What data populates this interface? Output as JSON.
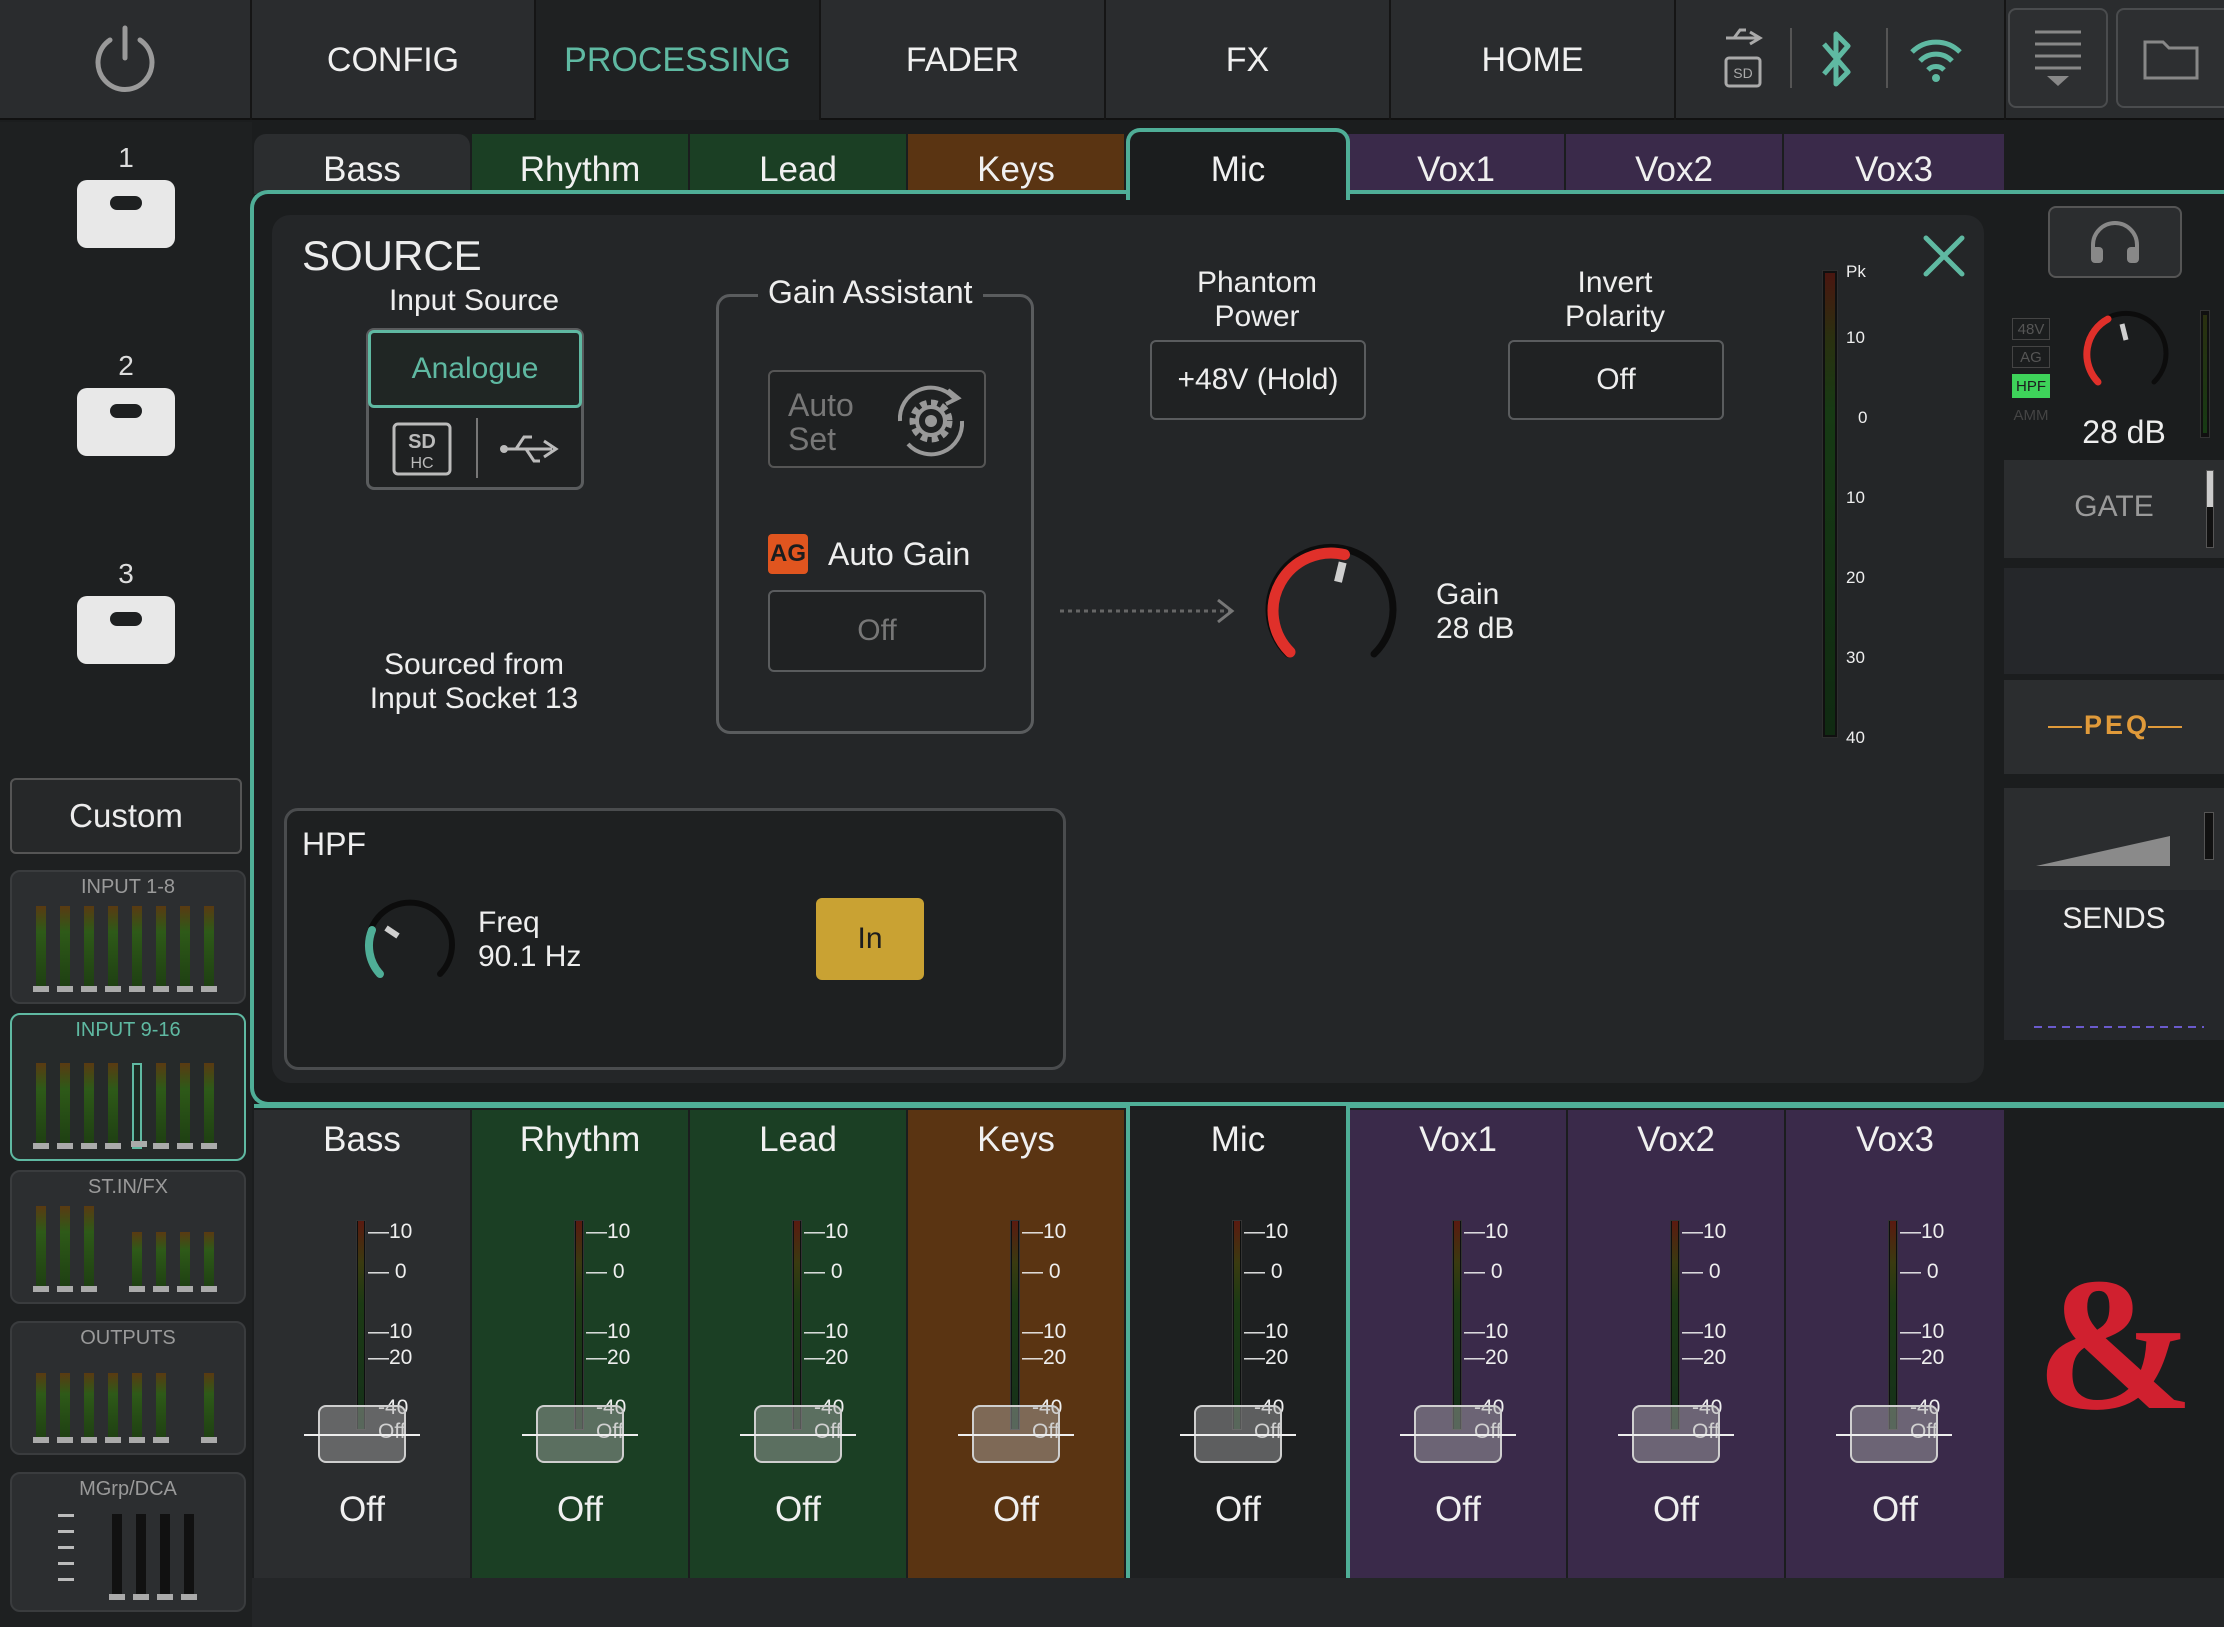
{
  "topbar": {
    "tabs": [
      {
        "label": "CONFIG"
      },
      {
        "label": "PROCESSING"
      },
      {
        "label": "FADER"
      },
      {
        "label": "FX"
      },
      {
        "label": "HOME"
      }
    ],
    "active_tab": "PROCESSING"
  },
  "scenes": [
    {
      "num": "1"
    },
    {
      "num": "2"
    },
    {
      "num": "3"
    }
  ],
  "left": {
    "custom_label": "Custom",
    "banks": [
      {
        "label": "INPUT 1-8"
      },
      {
        "label": "INPUT 9-16"
      },
      {
        "label": "ST.IN/FX"
      },
      {
        "label": "OUTPUTS"
      },
      {
        "label": "MGrp/DCA"
      }
    ]
  },
  "channel_tabs": [
    "Bass",
    "Rhythm",
    "Lead",
    "Keys",
    "Mic",
    "Vox1",
    "Vox2",
    "Vox3"
  ],
  "source": {
    "title": "SOURCE",
    "input_source_label": "Input Source",
    "input_source_value": "Analogue",
    "sourced_line1": "Sourced from",
    "sourced_line2": "Input Socket 13",
    "gain_assistant_title": "Gain Assistant",
    "auto_set_line1": "Auto",
    "auto_set_line2": "Set",
    "ag_badge": "AG",
    "auto_gain_label": "Auto Gain",
    "auto_gain_value": "Off",
    "phantom_line1": "Phantom",
    "phantom_line2": "Power",
    "phantom_value": "+48V (Hold)",
    "invert_line1": "Invert",
    "invert_line2": "Polarity",
    "invert_value": "Off",
    "gain_label": "Gain",
    "gain_value": "28 dB",
    "gain_level": 0.55,
    "meter_ticks": [
      "Pk",
      "10",
      "0",
      "10",
      "20",
      "30",
      "40"
    ]
  },
  "hpf": {
    "title": "HPF",
    "freq_label": "Freq",
    "freq_value": "90.1 Hz",
    "in_button": "In"
  },
  "right_strip": {
    "badges": [
      "48V",
      "AG",
      "HPF",
      "AMM"
    ],
    "gain_value": "28 dB",
    "gate_label": "GATE",
    "peq_label": "PEQ",
    "sends_label": "SENDS"
  },
  "strips": [
    {
      "name": "Bass",
      "state": "Off",
      "color": "#2b2d2f"
    },
    {
      "name": "Rhythm",
      "state": "Off",
      "color": "#1b3f24"
    },
    {
      "name": "Lead",
      "state": "Off",
      "color": "#1b3f24"
    },
    {
      "name": "Keys",
      "state": "Off",
      "color": "#5a3412"
    },
    {
      "name": "Mic",
      "state": "Off",
      "color": "#1e2021"
    },
    {
      "name": "Vox1",
      "state": "Off",
      "color": "#3a2a4a"
    },
    {
      "name": "Vox2",
      "state": "Off",
      "color": "#3a2a4a"
    },
    {
      "name": "Vox3",
      "state": "Off",
      "color": "#3a2a4a"
    }
  ],
  "fader_scale": [
    "10",
    "0",
    "10",
    "20",
    "40",
    "Off"
  ],
  "colors": {
    "accent": "#5fb9a2",
    "gain_red": "#e0302a",
    "in_button": "#c9a233",
    "peq": "#e09a3a",
    "ag_badge": "#e0551f",
    "brand_red": "#d0202f"
  }
}
